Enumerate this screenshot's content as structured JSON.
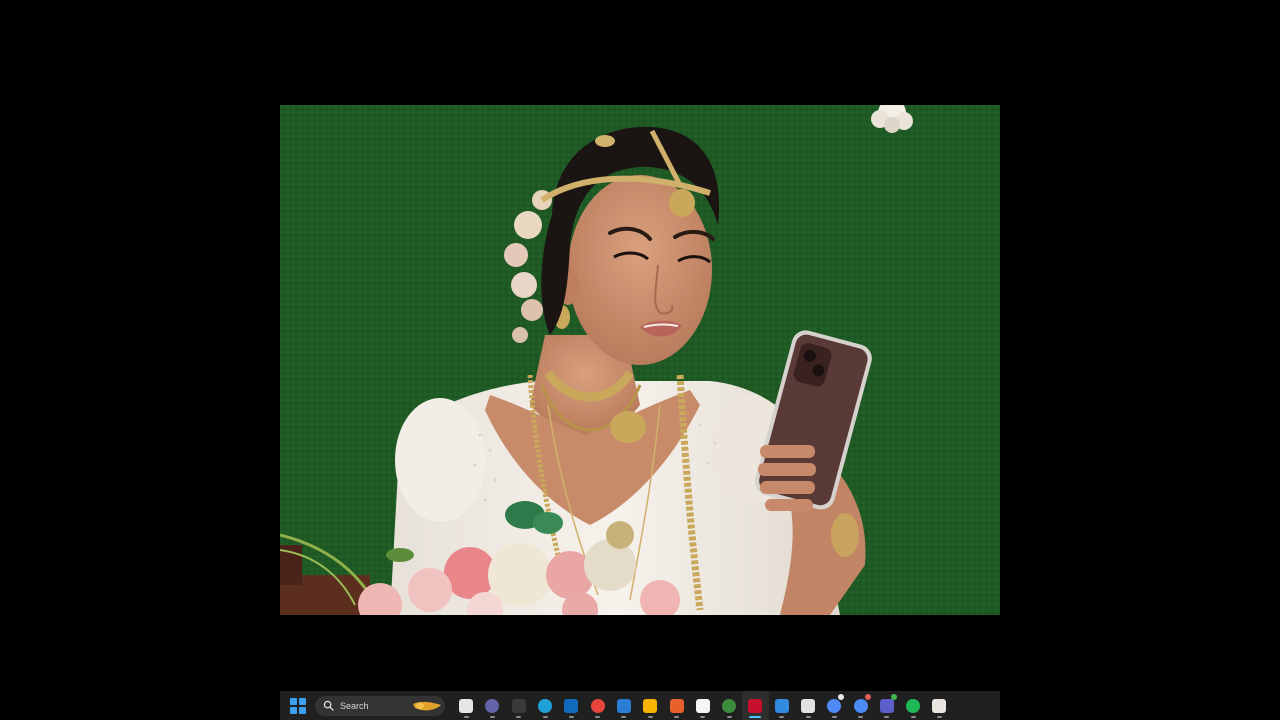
{
  "window": {
    "background": "#000000"
  },
  "video": {
    "scene_palette": {
      "backdrop": "#1f5a24",
      "saree": "#f1ece4",
      "skin": "#c98d6c",
      "hair": "#1a1412",
      "gold": "#c9a85c",
      "phone_case": "#5a3a36",
      "flower_pink": "#eaa6a4",
      "flower_cream": "#efe6d6"
    }
  },
  "taskbar": {
    "background": "#202020",
    "accent": "#4cc2ff",
    "search": {
      "label": "Search"
    },
    "icons": [
      {
        "name": "task-view-icon",
        "color": "#e6e6e6",
        "text": ""
      },
      {
        "name": "chat-icon",
        "color": "#6264a7",
        "text": ""
      },
      {
        "name": "calendar-2024-icon",
        "color": "#3a3a3a",
        "text": ""
      },
      {
        "name": "edge-icon",
        "color": "#1fa2d8",
        "text": ""
      },
      {
        "name": "outlook-icon",
        "color": "#0f6cbd",
        "text": ""
      },
      {
        "name": "chrome-icon",
        "color": "#e8453c",
        "text": ""
      },
      {
        "name": "power-automate-icon",
        "color": "#2b7cd3",
        "text": ""
      },
      {
        "name": "file-explorer-icon",
        "color": "#f4b400",
        "text": ""
      },
      {
        "name": "office-icon",
        "color": "#e8612c",
        "text": ""
      },
      {
        "name": "capcut-icon",
        "color": "#f5f5f5",
        "text": ""
      },
      {
        "name": "settings-hex-icon",
        "color": "#3d8b3d",
        "text": ""
      },
      {
        "name": "video-editor-icon",
        "color": "#c8102e",
        "text": "",
        "active": true
      },
      {
        "name": "notepad-icon",
        "color": "#2f8ae0",
        "text": ""
      },
      {
        "name": "snipping-tool-icon",
        "color": "#e0e0e0",
        "text": ""
      },
      {
        "name": "chrome-profile-icon",
        "color": "#4c8bf5",
        "text": "",
        "badge": "#e8e8e8"
      },
      {
        "name": "chrome-profile-2-icon",
        "color": "#4c8bf5",
        "text": "",
        "badge": "#e05a5a"
      },
      {
        "name": "teams-icon",
        "color": "#5b5fc7",
        "text": "",
        "badge": "#3fb950"
      },
      {
        "name": "spotify-icon",
        "color": "#1db954",
        "text": ""
      },
      {
        "name": "powerpoint-icon",
        "color": "#e8e4e0",
        "text": ""
      }
    ]
  }
}
